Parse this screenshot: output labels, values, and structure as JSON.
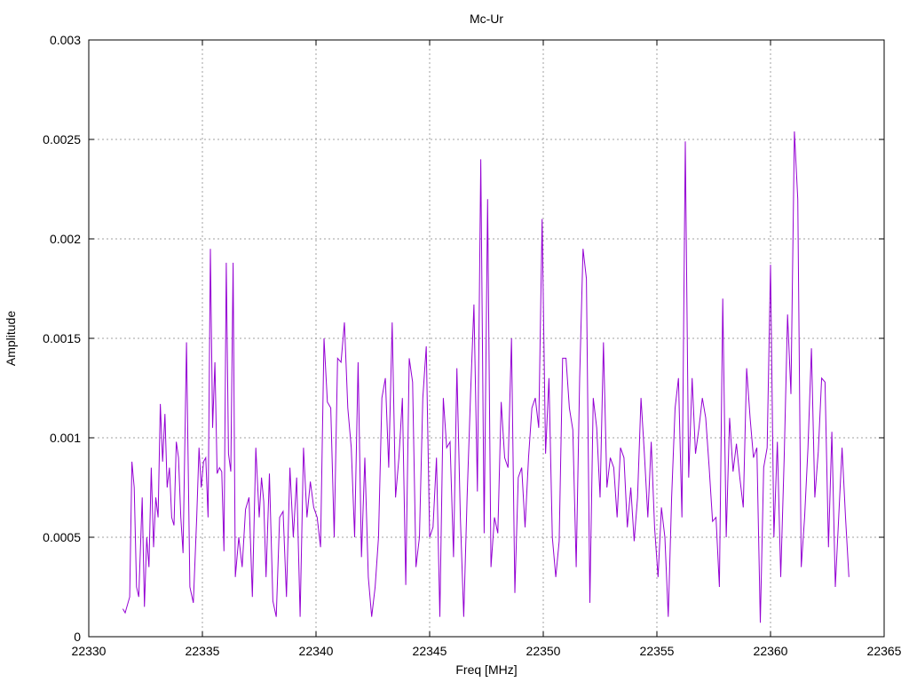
{
  "chart_data": {
    "type": "line",
    "title": "Mc-Ur",
    "xlabel": "Freq [MHz]",
    "ylabel": "Amplitude",
    "xlim": [
      22330,
      22365
    ],
    "ylim": [
      0,
      0.003
    ],
    "x_ticks": [
      "22330",
      "22335",
      "22340",
      "22345",
      "22350",
      "22355",
      "22360",
      "22365"
    ],
    "y_ticks": [
      "0",
      "0.0005",
      "0.001",
      "0.0015",
      "0.002",
      "0.0025",
      "0.003"
    ],
    "grid": true,
    "series": [
      {
        "color": "#9400d3",
        "x": [
          22331.5,
          22331.6,
          22331.8,
          22331.9,
          22332.0,
          22332.1,
          22332.2,
          22332.35,
          22332.45,
          22332.55,
          22332.65,
          22332.75,
          22332.85,
          22332.95,
          22333.05,
          22333.15,
          22333.25,
          22333.35,
          22333.45,
          22333.55,
          22333.65,
          22333.75,
          22333.85,
          22333.95,
          22334.05,
          22334.15,
          22334.3,
          22334.45,
          22334.6,
          22334.75,
          22334.85,
          22334.95,
          22335.05,
          22335.15,
          22335.25,
          22335.35,
          22335.45,
          22335.55,
          22335.65,
          22335.75,
          22335.85,
          22335.95,
          22336.05,
          22336.15,
          22336.25,
          22336.35,
          22336.45,
          22336.6,
          22336.75,
          22336.9,
          22337.05,
          22337.2,
          22337.35,
          22337.5,
          22337.6,
          22337.7,
          22337.8,
          22337.95,
          22338.1,
          22338.25,
          22338.4,
          22338.55,
          22338.7,
          22338.85,
          22339.0,
          22339.15,
          22339.3,
          22339.45,
          22339.6,
          22339.75,
          22339.9,
          22340.05,
          22340.2,
          22340.35,
          22340.5,
          22340.65,
          22340.8,
          22340.95,
          22341.1,
          22341.25,
          22341.4,
          22341.55,
          22341.7,
          22341.85,
          22342.0,
          22342.15,
          22342.3,
          22342.45,
          22342.6,
          22342.75,
          22342.9,
          22343.05,
          22343.2,
          22343.35,
          22343.5,
          22343.65,
          22343.8,
          22343.95,
          22344.1,
          22344.25,
          22344.4,
          22344.55,
          22344.7,
          22344.85,
          22345.0,
          22345.15,
          22345.3,
          22345.45,
          22345.6,
          22345.75,
          22345.9,
          22346.05,
          22346.2,
          22346.35,
          22346.5,
          22346.65,
          22346.8,
          22346.95,
          22347.1,
          22347.25,
          22347.4,
          22347.55,
          22347.7,
          22347.85,
          22348.0,
          22348.15,
          22348.3,
          22348.45,
          22348.6,
          22348.75,
          22348.9,
          22349.05,
          22349.2,
          22349.35,
          22349.5,
          22349.65,
          22349.8,
          22349.95,
          22350.1,
          22350.25,
          22350.4,
          22350.55,
          22350.7,
          22350.85,
          22351.0,
          22351.15,
          22351.3,
          22351.45,
          22351.6,
          22351.75,
          22351.9,
          22352.05,
          22352.2,
          22352.35,
          22352.5,
          22352.65,
          22352.8,
          22352.95,
          22353.1,
          22353.25,
          22353.4,
          22353.55,
          22353.7,
          22353.85,
          22354.0,
          22354.15,
          22354.3,
          22354.45,
          22354.6,
          22354.75,
          22354.9,
          22355.05,
          22355.2,
          22355.35,
          22355.5,
          22355.65,
          22355.8,
          22355.95,
          22356.1,
          22356.25,
          22356.4,
          22356.55,
          22356.7,
          22356.85,
          22357.0,
          22357.15,
          22357.3,
          22357.45,
          22357.6,
          22357.75,
          22357.9,
          22358.05,
          22358.2,
          22358.35,
          22358.5,
          22358.65,
          22358.8,
          22358.95,
          22359.1,
          22359.25,
          22359.4,
          22359.55,
          22359.7,
          22359.85,
          22360.0,
          22360.15,
          22360.3,
          22360.45,
          22360.6,
          22360.75,
          22360.9,
          22361.05,
          22361.2,
          22361.35,
          22361.5,
          22361.65,
          22361.8,
          22361.95,
          22362.1,
          22362.25,
          22362.4,
          22362.55,
          22362.7,
          22362.85,
          22363.0,
          22363.15,
          22363.3,
          22363.45
        ],
        "y": [
          0.00014,
          0.00012,
          0.0002,
          0.00088,
          0.00075,
          0.00025,
          0.0002,
          0.0007,
          0.00015,
          0.0005,
          0.00035,
          0.00085,
          0.00045,
          0.0007,
          0.0006,
          0.00117,
          0.00088,
          0.00112,
          0.00075,
          0.00085,
          0.0006,
          0.00056,
          0.00098,
          0.0009,
          0.0006,
          0.00042,
          0.00148,
          0.00025,
          0.00017,
          0.0006,
          0.00095,
          0.00075,
          0.00088,
          0.0009,
          0.0006,
          0.00195,
          0.00105,
          0.00138,
          0.00082,
          0.00085,
          0.00083,
          0.00043,
          0.00188,
          0.00092,
          0.00083,
          0.00188,
          0.0003,
          0.0005,
          0.00035,
          0.00064,
          0.0007,
          0.0002,
          0.00095,
          0.0006,
          0.0008,
          0.00068,
          0.0003,
          0.00082,
          0.00018,
          0.0001,
          0.0006,
          0.00063,
          0.0002,
          0.00085,
          0.0005,
          0.0008,
          0.0001,
          0.00095,
          0.0006,
          0.00078,
          0.00065,
          0.0006,
          0.00045,
          0.0015,
          0.00118,
          0.00115,
          0.0005,
          0.0014,
          0.00138,
          0.00158,
          0.00115,
          0.00095,
          0.0005,
          0.00138,
          0.0004,
          0.0009,
          0.0003,
          0.0001,
          0.00025,
          0.0005,
          0.0012,
          0.0013,
          0.00085,
          0.00158,
          0.0007,
          0.0009,
          0.0012,
          0.00026,
          0.0014,
          0.00128,
          0.00035,
          0.0005,
          0.0012,
          0.00146,
          0.0005,
          0.00055,
          0.0009,
          0.0001,
          0.0012,
          0.00095,
          0.00098,
          0.0004,
          0.00135,
          0.0006,
          0.0001,
          0.0007,
          0.00122,
          0.00167,
          0.00073,
          0.0024,
          0.00052,
          0.0022,
          0.00035,
          0.0006,
          0.00052,
          0.00118,
          0.0009,
          0.00085,
          0.0015,
          0.00022,
          0.0008,
          0.00085,
          0.00055,
          0.0009,
          0.00115,
          0.0012,
          0.00105,
          0.0021,
          0.00092,
          0.0013,
          0.0005,
          0.0003,
          0.00048,
          0.0014,
          0.0014,
          0.00115,
          0.00104,
          0.00035,
          0.0013,
          0.00195,
          0.0018,
          0.00017,
          0.0012,
          0.00105,
          0.0007,
          0.00148,
          0.00075,
          0.0009,
          0.00085,
          0.0006,
          0.00095,
          0.0009,
          0.00055,
          0.00075,
          0.00048,
          0.0007,
          0.0012,
          0.00092,
          0.0006,
          0.00098,
          0.00055,
          0.0003,
          0.00065,
          0.0005,
          0.0001,
          0.0007,
          0.00115,
          0.0013,
          0.0006,
          0.00249,
          0.0008,
          0.0013,
          0.00092,
          0.00105,
          0.0012,
          0.0011,
          0.00085,
          0.00058,
          0.0006,
          0.00025,
          0.0017,
          0.0005,
          0.0011,
          0.00083,
          0.00097,
          0.0008,
          0.00065,
          0.00135,
          0.0011,
          0.0009,
          0.00095,
          7e-05,
          0.00085,
          0.00095,
          0.00187,
          0.0005,
          0.00098,
          0.0003,
          0.0009,
          0.00162,
          0.00122,
          0.00254,
          0.0022,
          0.00035,
          0.0006,
          0.00095,
          0.00145,
          0.0007,
          0.00093,
          0.0013,
          0.00128,
          0.00045,
          0.00103,
          0.00025,
          0.0006,
          0.00095,
          0.0006,
          0.0003
        ]
      }
    ]
  }
}
